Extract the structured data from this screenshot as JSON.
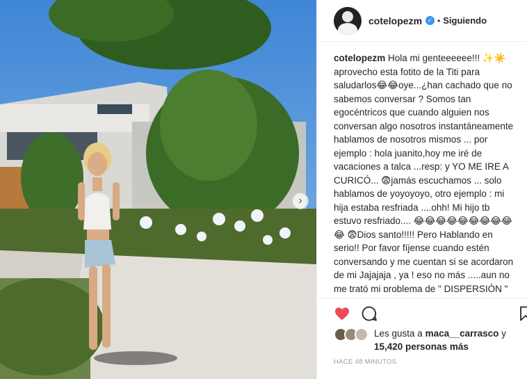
{
  "post": {
    "username": "cotelopezm",
    "verified": true,
    "follow_status": "Siguiendo",
    "separator": "•",
    "caption_text": "Hola mi genteeeeee!!! ✨☀️ aprovecho esta fotito de la Titi para saludarlos😂😂oye...¿han cachado que no sabemos conversar ? Somos tan egocéntricos que cuando alguien nos conversan algo nosotros instantáneamente hablamos de nosotros mismos ... por ejemplo : hola juanito,hoy me iré de vacaciones a talca ...resp: y YO ME IRE A CURICÓ... 😨jamás escuchamos ... solo hablamos de yoyoyoyo, otro ejemplo : mi hija estaba resfriada ....ohh! Mi hijo tb estuvo resfriado.... 😂😂😂😂😂😂😂😂😂😂 😨Dios santo!!!!! Pero Hablando en serio!! Por favor fíjense cuando estén conversando y me cuentan si se acordaron de mi Jajajaja , ya ! eso no más .....aun no me trató mi problema de \" DISPERSIÓN \" Jajajaja adió 🫡 😍❣️✨🖤",
    "likes": {
      "prefix": "Les gusta a",
      "user": "maca__carrasco",
      "conjunction": "y",
      "others": "15,420 personas más"
    },
    "timestamp": "HACE 48 MINUTOS"
  },
  "icons": {
    "like": "heart-filled-icon",
    "comment": "comment-bubble-icon",
    "save": "bookmark-icon",
    "next": "chevron-right-icon"
  },
  "colors": {
    "like_red": "#ed4956",
    "verified_blue": "#3897f0",
    "muted": "#999999"
  }
}
